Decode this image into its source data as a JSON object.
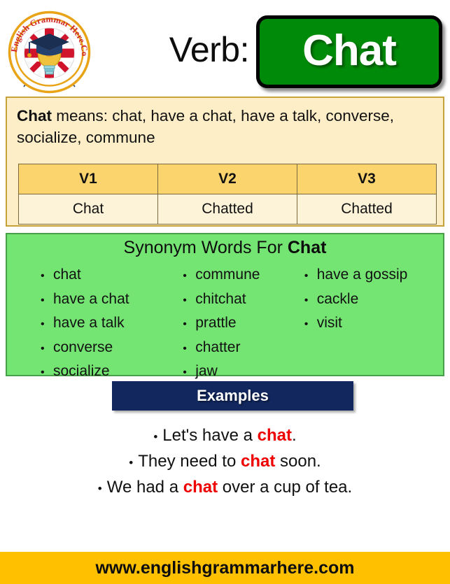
{
  "header": {
    "logo_alt": "English Grammar Here.Com",
    "logo_text": "English Grammar Here.Com",
    "verb_label": "Verb:",
    "verb_value": "Chat",
    "chip_color": "#008a09"
  },
  "meaning": {
    "word": "Chat",
    "means_label": " means: ",
    "definitions": "chat, have a chat, have a talk, converse, socialize, commune",
    "table": {
      "headers": [
        "V1",
        "V2",
        "V3"
      ],
      "rows": [
        [
          "Chat",
          "Chatted",
          "Chatted"
        ]
      ],
      "header_bg": "#fbd46d",
      "cell_bg": "#fdf3d8"
    },
    "panel_bg": "#fdeec8"
  },
  "synonyms": {
    "title_prefix": "Synonym Words For ",
    "title_word": "Chat",
    "panel_bg": "#74e572",
    "columns": [
      [
        "chat",
        "have a chat",
        "have a talk",
        "converse",
        "socialize"
      ],
      [
        "commune",
        "chitchat",
        "prattle",
        "chatter",
        "jaw"
      ],
      [
        "have a gossip",
        "cackle",
        "visit"
      ]
    ]
  },
  "examples": {
    "banner_label": "Examples",
    "banner_bg": "#11275e",
    "highlight_color": "#ef0000",
    "items": [
      {
        "pre": "Let's have a ",
        "highlight": "chat",
        "post": "."
      },
      {
        "pre": "They need to ",
        "highlight": "chat",
        "post": " soon."
      },
      {
        "pre": "We had a ",
        "highlight": "chat",
        "post": " over a cup of tea."
      }
    ]
  },
  "footer": {
    "url": "www.englishgrammarhere.com",
    "bg": "#ffc000"
  }
}
